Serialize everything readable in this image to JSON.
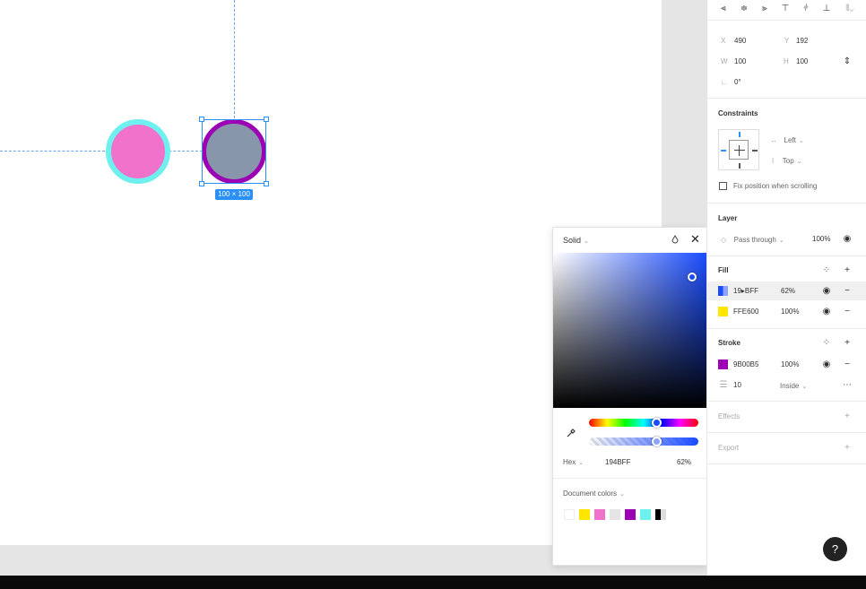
{
  "canvas": {
    "selection_size": "100 × 100",
    "shape_a": {
      "fill": "#f072cb",
      "stroke": "#6ef0ee"
    },
    "shape_b": {
      "fill": "#8796ab",
      "stroke": "#9b00b5"
    }
  },
  "picker": {
    "mode": "Solid",
    "hex_label": "Hex",
    "hex_value": "194BFF",
    "opacity": "62%",
    "doc_colors_label": "Document colors",
    "swatches": [
      "#ffffff",
      "#ffe600",
      "#f072cb",
      "#e5e5e5",
      "#9b00b5",
      "#6ef0ee",
      "#000000"
    ]
  },
  "panel": {
    "x_label": "X",
    "x_value": "490",
    "y_label": "Y",
    "y_value": "192",
    "w_label": "W",
    "w_value": "100",
    "h_label": "H",
    "h_value": "100",
    "rotation_value": "0°",
    "constraints": {
      "title": "Constraints",
      "horizontal": "Left",
      "vertical": "Top",
      "fix_position": "Fix position when scrolling"
    },
    "layer": {
      "title": "Layer",
      "blend": "Pass through",
      "opacity": "100%"
    },
    "fill": {
      "title": "Fill",
      "items": [
        {
          "hex": "194BFF",
          "display_hex": "19▸BFF",
          "opacity": "62%",
          "color": "#194bff"
        },
        {
          "hex": "FFE600",
          "display_hex": "FFE600",
          "opacity": "100%",
          "color": "#ffe600"
        }
      ]
    },
    "stroke": {
      "title": "Stroke",
      "hex": "9B00B5",
      "opacity": "100%",
      "color": "#9b00b5",
      "weight": "10",
      "position": "Inside"
    },
    "effects_title": "Effects",
    "export_title": "Export"
  },
  "help_label": "?"
}
